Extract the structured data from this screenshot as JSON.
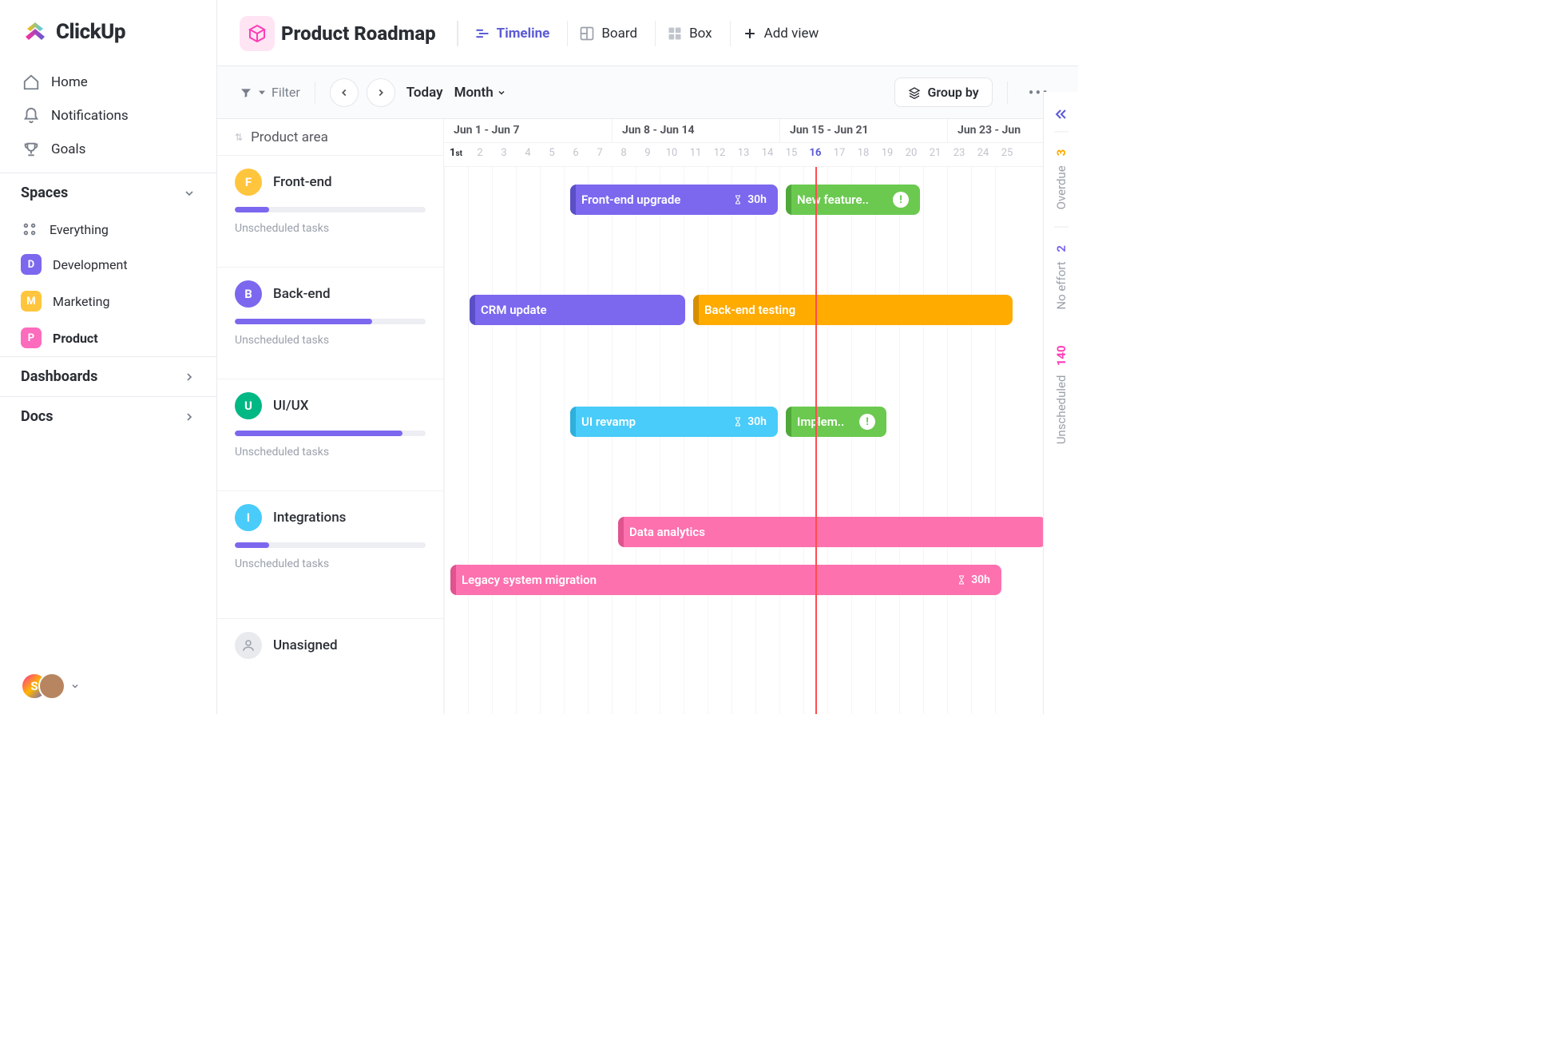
{
  "brand": "ClickUp",
  "nav": {
    "home": "Home",
    "notifications": "Notifications",
    "goals": "Goals"
  },
  "spaces": {
    "header": "Spaces",
    "everything": "Everything",
    "items": [
      {
        "letter": "D",
        "label": "Development"
      },
      {
        "letter": "M",
        "label": "Marketing"
      },
      {
        "letter": "P",
        "label": "Product"
      }
    ]
  },
  "dashboards_label": "Dashboards",
  "docs_label": "Docs",
  "user_initial": "S",
  "page": {
    "title": "Product Roadmap",
    "views": {
      "timeline": "Timeline",
      "board": "Board",
      "box": "Box",
      "add": "Add view"
    }
  },
  "toolbar": {
    "filter": "Filter",
    "today": "Today",
    "range": "Month",
    "group_by": "Group by"
  },
  "column_label": "Product area",
  "weeks": [
    "Jun 1 - Jun 7",
    "Jun 8 - Jun 14",
    "Jun 15 - Jun 21",
    "Jun 23 - Jun"
  ],
  "days": [
    "1",
    "2",
    "3",
    "4",
    "5",
    "6",
    "7",
    "8",
    "9",
    "10",
    "11",
    "12",
    "13",
    "14",
    "15",
    "16",
    "17",
    "18",
    "19",
    "20",
    "21",
    "23",
    "24",
    "25"
  ],
  "today_day": "16",
  "groups": [
    {
      "letter": "F",
      "name": "Front-end",
      "progress": 18,
      "unscheduled": "Unscheduled tasks"
    },
    {
      "letter": "B",
      "name": "Back-end",
      "progress": 72,
      "unscheduled": "Unscheduled tasks"
    },
    {
      "letter": "U",
      "name": "UI/UX",
      "progress": 88,
      "unscheduled": "Unscheduled tasks"
    },
    {
      "letter": "I",
      "name": "Integrations",
      "progress": 18,
      "unscheduled": "Unscheduled tasks"
    },
    {
      "letter": "",
      "name": "Unasigned"
    }
  ],
  "tasks": {
    "fe_upgrade": {
      "label": "Front-end upgrade",
      "hours": "30h"
    },
    "new_feature": {
      "label": "New feature..",
      "alert": "!"
    },
    "crm": {
      "label": "CRM update"
    },
    "be_test": {
      "label": "Back-end testing"
    },
    "ui_revamp": {
      "label": "UI revamp",
      "hours": "30h"
    },
    "implem": {
      "label": "Implem..",
      "alert": "!"
    },
    "data": {
      "label": "Data analytics"
    },
    "legacy": {
      "label": "Legacy system migration",
      "hours": "30h"
    }
  },
  "rail": {
    "overdue": {
      "count": "3",
      "label": "Overdue"
    },
    "noeffort": {
      "count": "2",
      "label": "No effort"
    },
    "unscheduled": {
      "count": "140",
      "label": "Unscheduled"
    }
  }
}
